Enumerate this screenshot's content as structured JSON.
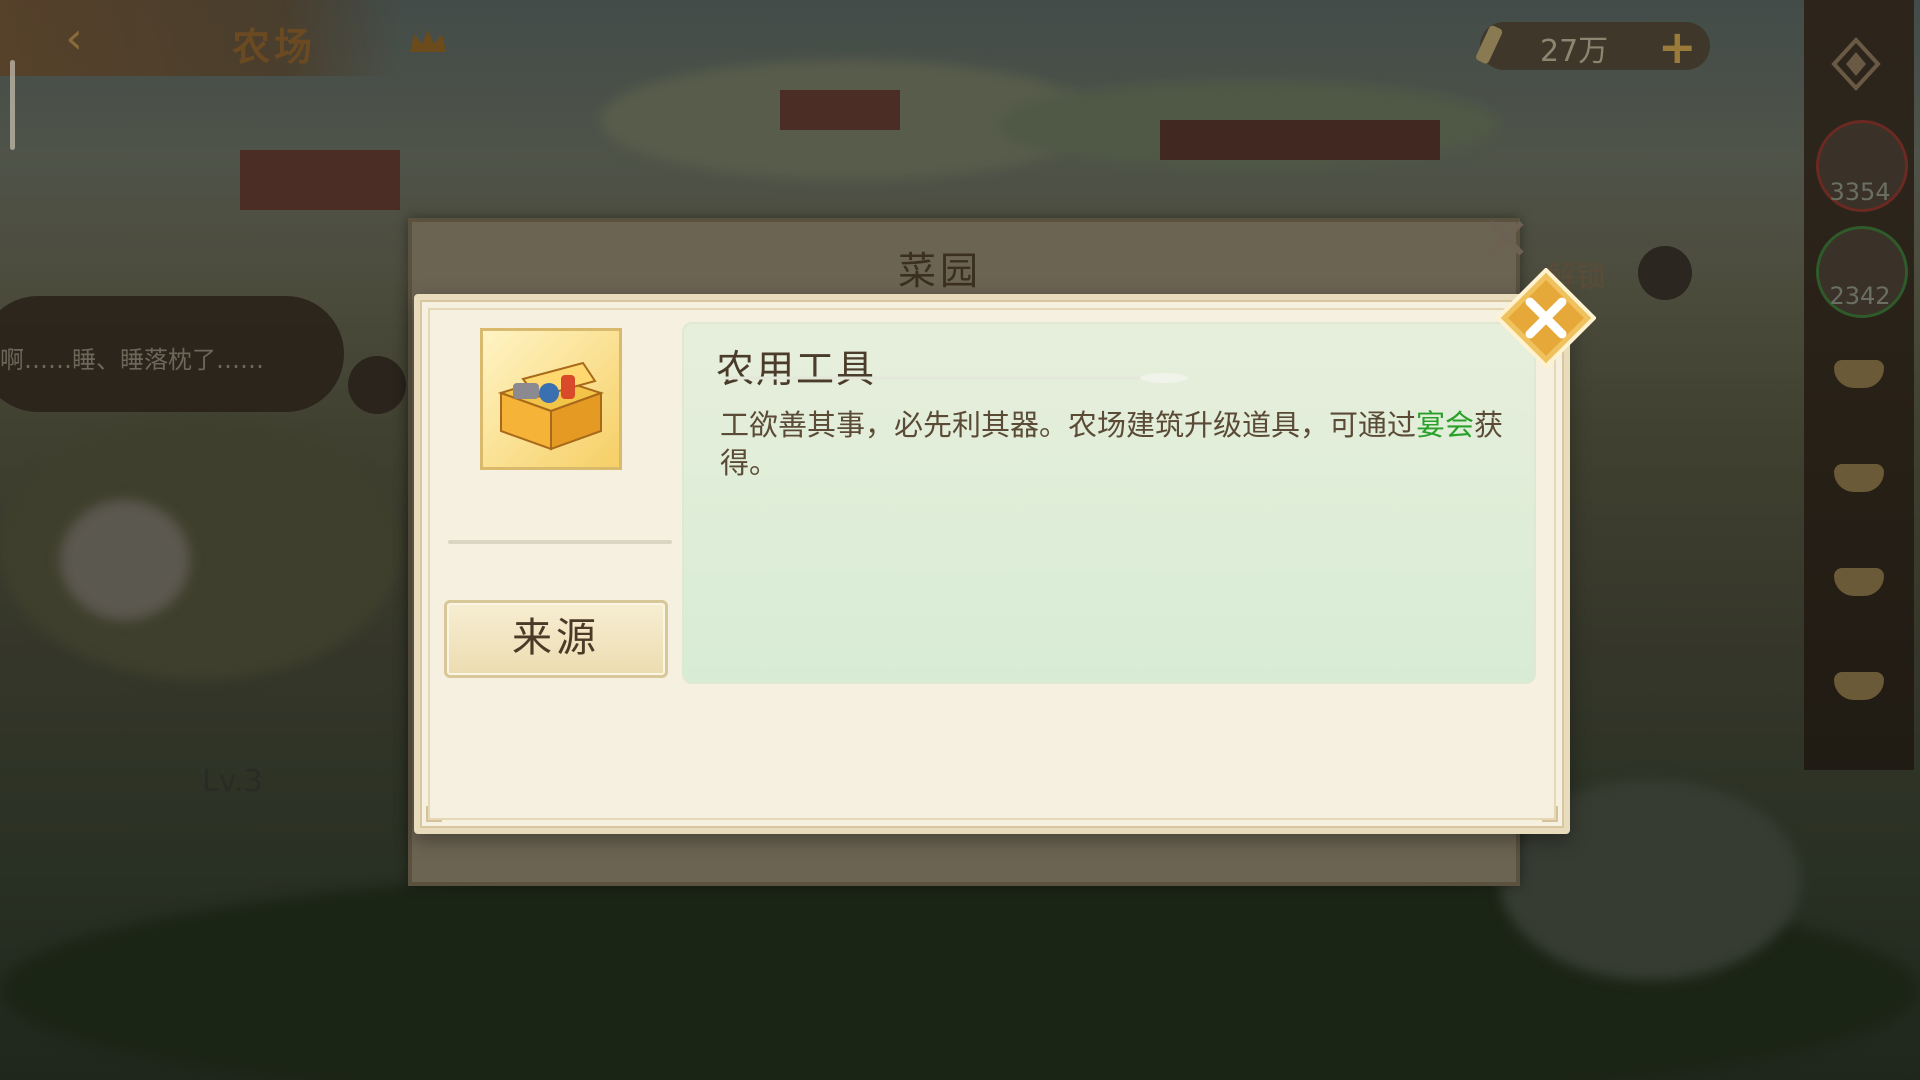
{
  "header": {
    "back_icon": "back-arrow-icon",
    "title": "农场",
    "crown_icon": "crown-icon"
  },
  "currency": {
    "icon": "scroll-icon",
    "value": "27万",
    "add_label": "+"
  },
  "sidebar": {
    "compass_icon": "compass-icon",
    "resources": [
      {
        "icon": "vegetable-icon",
        "value": "3354"
      },
      {
        "icon": "ore-icon",
        "value": "2342"
      }
    ],
    "slot_icon": "empty-slot-icon"
  },
  "background_popup": {
    "title": "菜园",
    "unlock_label": "解锁"
  },
  "chat": {
    "text": "啊……睡、睡落枕了……"
  },
  "building": {
    "level": "Lv.3"
  },
  "dialog": {
    "item_icon": "toolbox-icon",
    "item_name": "农用工具",
    "description_main": "工欲善其事，必先利其器。农场建筑升级道具，可通过",
    "description_highlight": "宴会",
    "description_tail": "获得。",
    "source_button": "来源",
    "close_icon": "close-icon",
    "highlight_color": "#2aa12a"
  }
}
